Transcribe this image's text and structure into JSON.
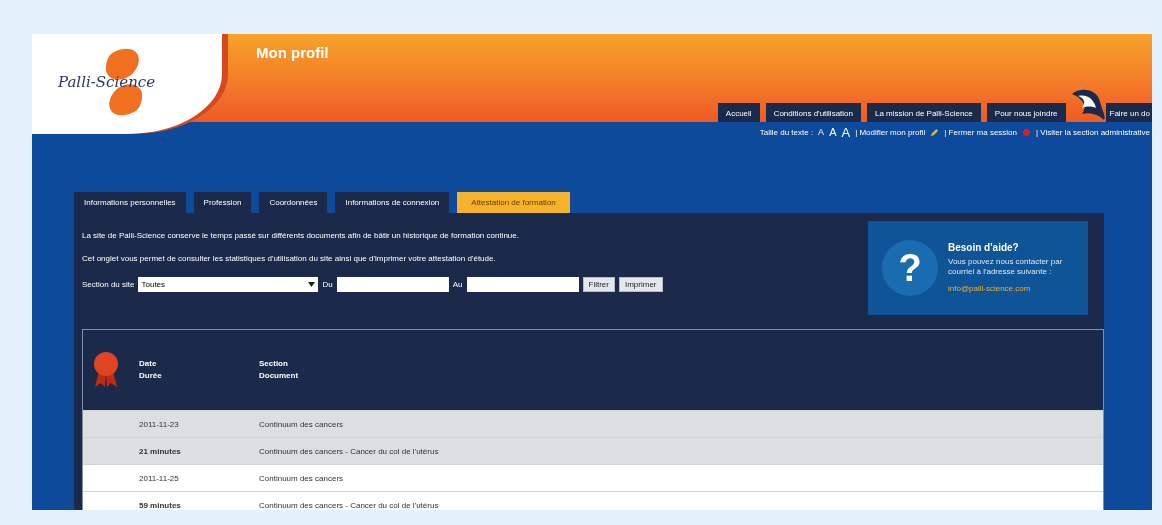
{
  "logo": {
    "text": "Palli-Science"
  },
  "page_title": "Mon profil",
  "nav": [
    {
      "label": "Accueil"
    },
    {
      "label": "Conditions d'utilisation"
    },
    {
      "label": "La mission de Palli-Science"
    },
    {
      "label": "Pour nous joindre"
    },
    {
      "label": "Faire un do"
    }
  ],
  "utility_links": {
    "text_size_label": "Taille du texte :",
    "text_sizes": [
      "A",
      "A",
      "A"
    ],
    "links": [
      {
        "label": "| Modifier mon profil"
      },
      {
        "label": "| Fermer ma session"
      },
      {
        "label": "| Visiter la section administrative"
      }
    ]
  },
  "tabs": [
    {
      "label": "Informations personnelles",
      "selected": false
    },
    {
      "label": "Profession",
      "selected": false
    },
    {
      "label": "Coordonnées",
      "selected": false
    },
    {
      "label": "Informations de connexion",
      "selected": false
    },
    {
      "label": "Attestation de formation",
      "selected": true
    }
  ],
  "intro": [
    "La site de Palli-Science conserve le temps passé sur différents documents afin de bâtir un historique de formation continue.",
    "Cet onglet vous permet de consulter les statistiques d'utilisation du site ainsi que d'imprimer votre attestation d'étude."
  ],
  "filter": {
    "section_label": "Section du site",
    "section_value": "Toutes",
    "from_label": "Du",
    "to_label": "Au",
    "buttons": [
      "Filtrer",
      "Imprimer"
    ]
  },
  "help": {
    "icon_text": "?",
    "title": "Besoin d'aide?",
    "text": "Vous pouvez nous contacter par courriel à l'adresse suivante :",
    "email": "info@palli-science.com"
  },
  "table": {
    "columns": [
      {
        "line1": "Date",
        "line2": "Durée"
      },
      {
        "line1": "Section",
        "line2": "Document"
      }
    ],
    "rows": [
      {
        "date": "2011-11-23",
        "duration": "21 minutes",
        "section": "Continuum des cancers",
        "document": "Continuum des cancers - Cancer du col de l'utérus"
      },
      {
        "date": "2011-11-25",
        "duration": "59 minutes",
        "section": "Continuum des cancers",
        "document": "Continuum des cancers - Cancer du col de l'utérus"
      }
    ]
  }
}
